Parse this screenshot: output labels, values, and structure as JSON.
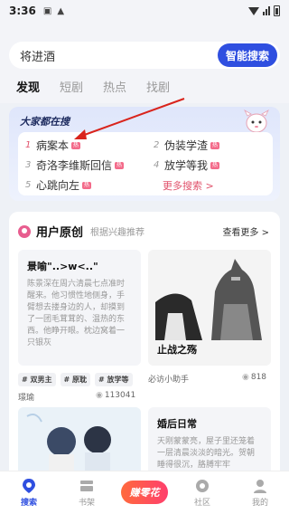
{
  "status_bar": {
    "time": "3:36"
  },
  "search": {
    "query": "将进酒",
    "button_label": "智能搜索"
  },
  "tabs": [
    "发现",
    "短剧",
    "热点",
    "找剧"
  ],
  "hot_search": {
    "title": "大家都在搜",
    "items": [
      {
        "rank": "1",
        "label": "病案本",
        "tag": "热"
      },
      {
        "rank": "2",
        "label": "伪装学渣",
        "tag": "热"
      },
      {
        "rank": "3",
        "label": "奇洛李维斯回信",
        "tag": "热"
      },
      {
        "rank": "4",
        "label": "放学等我",
        "tag": "热"
      },
      {
        "rank": "5",
        "label": "心跳向左",
        "tag": "热"
      }
    ],
    "more_label": "更多搜索 >"
  },
  "original": {
    "title": "用户原创",
    "subtitle": "根据兴趣推荐",
    "see_more": "查看更多 >",
    "work1": {
      "title": "景喻\"..>w<..\"",
      "body": "陈景深在周六清晨七点准时醒来。他习惯性地侧身，手臂想去搂身边的人，却摸到了一团毛茸茸的、温热的东西。他睁开眼。枕边窝着一只银灰",
      "tags": [
        "# 双男主",
        "# 原耽",
        "# 放学等"
      ],
      "author": "璟瑜",
      "views": "113041"
    },
    "work2": {
      "title": "止战之殇",
      "author": "必访小助手",
      "views": "818"
    },
    "work3": {
      "title": "婚后日常",
      "body": "天刚蒙蒙亮，屋子里还笼着一层清晨淡淡的暗光。贺朝睡得很沉，胳膊牢牢"
    }
  },
  "nav": [
    {
      "label": "搜索",
      "icon": "search-pin-icon"
    },
    {
      "label": "书架",
      "icon": "bookshelf-icon"
    },
    {
      "label": "赚零花",
      "icon": "earn-icon"
    },
    {
      "label": "社区",
      "icon": "community-icon"
    },
    {
      "label": "我的",
      "icon": "profile-icon"
    }
  ],
  "colors": {
    "accent": "#2f4fe0",
    "hot_tag": "#f36b8a",
    "highlight": "#e0506a"
  }
}
